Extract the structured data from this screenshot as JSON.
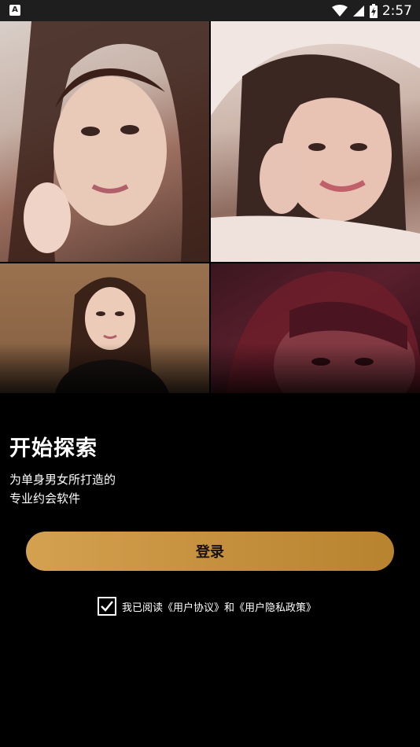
{
  "status_bar": {
    "app_icon_letter": "A",
    "time": "2:57"
  },
  "photos": [
    {
      "name": "profile-photo-1"
    },
    {
      "name": "profile-photo-2"
    },
    {
      "name": "profile-photo-3"
    },
    {
      "name": "profile-photo-4"
    }
  ],
  "hero": {
    "title": "开始探索",
    "subtitle_line1": "为单身男女所打造的",
    "subtitle_line2": "专业约会软件"
  },
  "login": {
    "label": "登录"
  },
  "agreement": {
    "checked": true,
    "prefix": "我已阅读",
    "user_agreement": "《用户协议》",
    "conjunction": "和",
    "privacy_policy": "《用户隐私政策》"
  },
  "colors": {
    "background": "#000000",
    "status_bar": "#1e1e1e",
    "button_gradient_start": "#d4a150",
    "button_gradient_end": "#b8832f"
  }
}
